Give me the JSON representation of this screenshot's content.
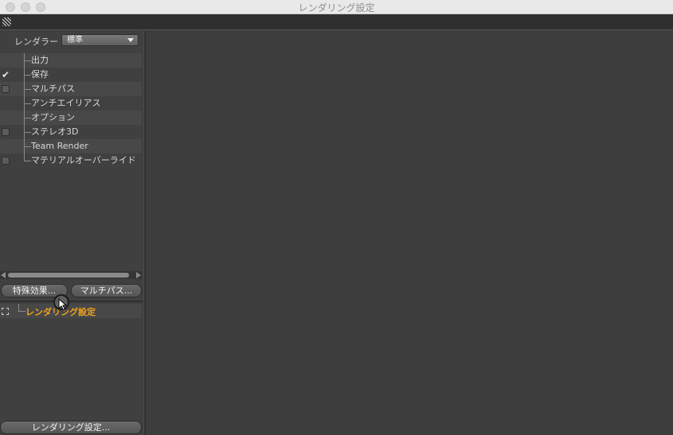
{
  "window": {
    "title": "レンダリング設定"
  },
  "renderer": {
    "label": "レンダラー",
    "selected": "標準"
  },
  "tree": {
    "items": [
      {
        "label": "出力",
        "checkbox": "none"
      },
      {
        "label": "保存",
        "checkbox": "checked"
      },
      {
        "label": "マルチパス",
        "checkbox": "unchecked"
      },
      {
        "label": "アンチエイリアス",
        "checkbox": "none"
      },
      {
        "label": "オプション",
        "checkbox": "none"
      },
      {
        "label": "ステレオ3D",
        "checkbox": "unchecked"
      },
      {
        "label": "Team Render",
        "checkbox": "none"
      },
      {
        "label": "マテリアルオーバーライド",
        "checkbox": "unchecked"
      }
    ]
  },
  "buttons": {
    "effects": "特殊効果...",
    "multipass": "マルチパス...",
    "render_settings": "レンダリング設定..."
  },
  "settings_list": {
    "active_item": "レンダリング設定",
    "icon": "settings-preset-icon"
  },
  "colors": {
    "active_item": "#f2a21e",
    "panel_bg": "#404040",
    "main_bg": "#3d3d3d"
  }
}
